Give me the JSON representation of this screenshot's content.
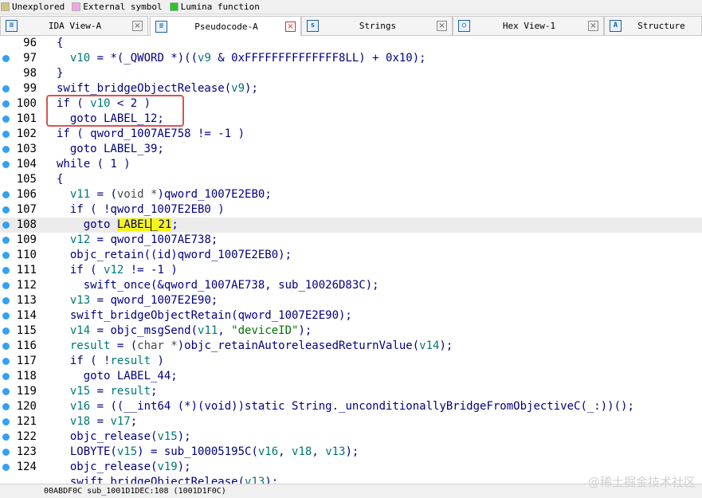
{
  "legend": [
    {
      "label": "Unexplored",
      "color": "#c8c878"
    },
    {
      "label": "External symbol",
      "color": "#f5a3e8"
    },
    {
      "label": "Lumina function",
      "color": "#28c828"
    }
  ],
  "tabs": [
    {
      "label": "IDA View-A",
      "icon": "ida-view-icon",
      "active": false
    },
    {
      "label": "Pseudocode-A",
      "icon": "pseudocode-icon",
      "active": true
    },
    {
      "label": "Strings",
      "icon": "strings-icon",
      "active": false
    },
    {
      "label": "Hex View-1",
      "icon": "hex-view-icon",
      "active": false
    },
    {
      "label": "Structure",
      "icon": "structures-icon",
      "active": false
    }
  ],
  "lines": [
    {
      "n": "96",
      "dot": false,
      "text": "{"
    },
    {
      "n": "97",
      "dot": true,
      "text": "  v10 = *(_QWORD *)((v9 & 0xFFFFFFFFFFFFFF8LL) + 0x10);"
    },
    {
      "n": "98",
      "dot": false,
      "text": "}"
    },
    {
      "n": "99",
      "dot": true,
      "text": "swift_bridgeObjectRelease(v9);"
    },
    {
      "n": "100",
      "dot": true,
      "text": "if ( v10 < 2 )"
    },
    {
      "n": "101",
      "dot": true,
      "text": "  goto LABEL_12;"
    },
    {
      "n": "102",
      "dot": true,
      "text": "if ( qword_1007AE758 != -1 )"
    },
    {
      "n": "103",
      "dot": true,
      "text": "  goto LABEL_39;"
    },
    {
      "n": "104",
      "dot": true,
      "text": "while ( 1 )"
    },
    {
      "n": "105",
      "dot": false,
      "text": "{"
    },
    {
      "n": "106",
      "dot": true,
      "text": "  v11 = (void *)qword_1007E2EB0;"
    },
    {
      "n": "107",
      "dot": true,
      "text": "  if ( !qword_1007E2EB0 )"
    },
    {
      "n": "108",
      "dot": true,
      "text": "    goto LABEL_21;"
    },
    {
      "n": "109",
      "dot": true,
      "text": "  v12 = qword_1007AE738;"
    },
    {
      "n": "110",
      "dot": true,
      "text": "  objc_retain((id)qword_1007E2EB0);"
    },
    {
      "n": "111",
      "dot": true,
      "text": "  if ( v12 != -1 )"
    },
    {
      "n": "112",
      "dot": true,
      "text": "    swift_once(&qword_1007AE738, sub_10026D83C);"
    },
    {
      "n": "113",
      "dot": true,
      "text": "  v13 = qword_1007E2E90;"
    },
    {
      "n": "114",
      "dot": true,
      "text": "  swift_bridgeObjectRetain(qword_1007E2E90);"
    },
    {
      "n": "115",
      "dot": true,
      "text": "  v14 = objc_msgSend(v11, \"deviceID\");"
    },
    {
      "n": "116",
      "dot": true,
      "text": "  result = (char *)objc_retainAutoreleasedReturnValue(v14);"
    },
    {
      "n": "117",
      "dot": true,
      "text": "  if ( !result )"
    },
    {
      "n": "118",
      "dot": true,
      "text": "    goto LABEL_44;"
    },
    {
      "n": "119",
      "dot": true,
      "text": "  v15 = result;"
    },
    {
      "n": "120",
      "dot": true,
      "text": "  v16 = ((__int64 (*)(void))static String._unconditionallyBridgeFromObjectiveC(_:))();"
    },
    {
      "n": "121",
      "dot": true,
      "text": "  v18 = v17;"
    },
    {
      "n": "122",
      "dot": true,
      "text": "  objc_release(v15);"
    },
    {
      "n": "123",
      "dot": true,
      "text": "  LOBYTE(v15) = sub_10005195C(v16, v18, v13);"
    },
    {
      "n": "124",
      "dot": true,
      "text": "  objc_release(v19);"
    },
    {
      "n": "",
      "dot": false,
      "text": "  swift_bridgeObjectRelease(v13);"
    }
  ],
  "status_text": "00ABDF0C sub_1001D1DEC:108 (1001D1F0C)",
  "watermark": "@稀土掘金技术社区",
  "colors": {
    "code_text": "#000080",
    "variable": "#007575",
    "string": "#007000",
    "highlight": "#f5f51a",
    "annotation_box": "#d9534f",
    "line_dot": "#33a1f0"
  }
}
